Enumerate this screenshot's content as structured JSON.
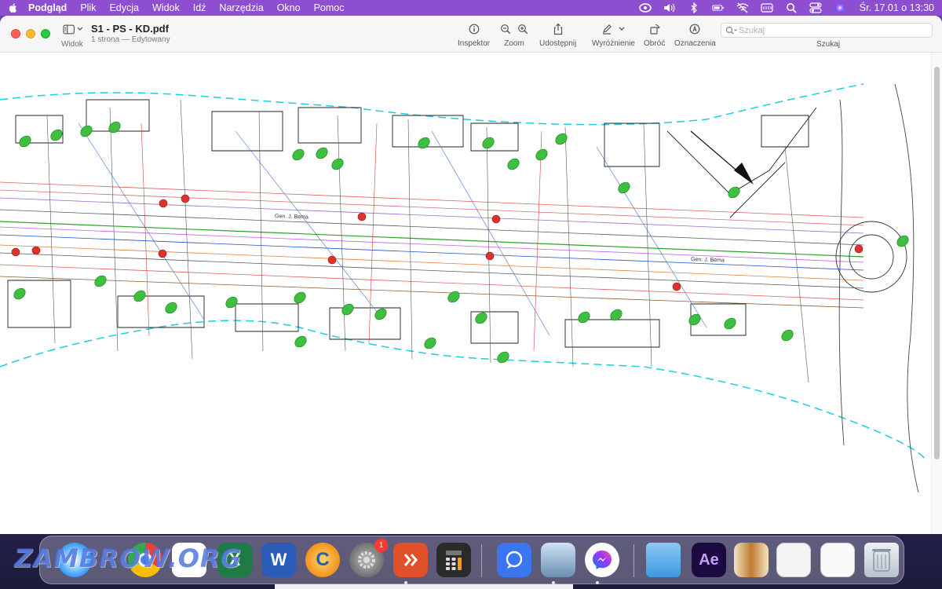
{
  "menubar": {
    "app_name": "Podgląd",
    "items": [
      "Plik",
      "Edycja",
      "Widok",
      "Idź",
      "Narzędzia",
      "Okno",
      "Pomoc"
    ],
    "clock": "Śr. 17.01 o 13:30"
  },
  "window": {
    "title": "S1 - PS - KD.pdf",
    "subtitle": "1 strona — Edytowany",
    "view_label": "Widok",
    "tools": [
      {
        "label": "Inspektor",
        "icon": "info-icon"
      },
      {
        "label": "Zoom",
        "icon": "zoom-icon"
      },
      {
        "label": "Udostępnij",
        "icon": "share-icon"
      },
      {
        "label": "Wyróżnienie",
        "icon": "highlight-icon"
      },
      {
        "label": "Obróć",
        "icon": "rotate-icon"
      },
      {
        "label": "Oznaczenia",
        "icon": "markup-icon"
      }
    ],
    "search": {
      "placeholder": "Szukaj",
      "label": "Szukaj"
    }
  },
  "document": {
    "street_label": "Gen. J. Bema",
    "colors": {
      "boundary": "#00d0e0",
      "marker_green": "#3fbf3f",
      "marker_red": "#e0302a"
    }
  },
  "dock": {
    "apps": [
      {
        "name": "Safari",
        "icon": "safari-icon"
      },
      {
        "name": "Chrome",
        "icon": "chrome-icon"
      },
      {
        "name": "Kalendarz",
        "icon": "calendar-icon"
      },
      {
        "name": "Excel",
        "icon": "excel-icon",
        "glyph": "X"
      },
      {
        "name": "Word",
        "icon": "word-icon",
        "glyph": "W"
      },
      {
        "name": "CCleaner",
        "icon": "ccleaner-icon",
        "glyph": "C"
      },
      {
        "name": "Ustawienia systemowe",
        "icon": "settings-icon",
        "badge": "1"
      },
      {
        "name": "Microsoft Remote Desktop",
        "icon": "remote-desktop-icon"
      },
      {
        "name": "Kalkulator",
        "icon": "calculator-icon"
      },
      {
        "name": "Signal",
        "icon": "signal-icon"
      },
      {
        "name": "Podgląd",
        "icon": "preview-icon"
      },
      {
        "name": "Messenger",
        "icon": "messenger-icon"
      },
      {
        "name": "Folder",
        "icon": "folder-icon"
      },
      {
        "name": "After Effects",
        "icon": "after-effects-icon",
        "glyph": "Ae"
      },
      {
        "name": "Dokument 1",
        "icon": "document-thumb-icon"
      },
      {
        "name": "Dokument 2",
        "icon": "document-thumb-icon"
      },
      {
        "name": "Dokument 3",
        "icon": "document-thumb-icon"
      },
      {
        "name": "Kosz",
        "icon": "trash-icon"
      }
    ],
    "watermark": "ZAMBROW.ORG"
  }
}
